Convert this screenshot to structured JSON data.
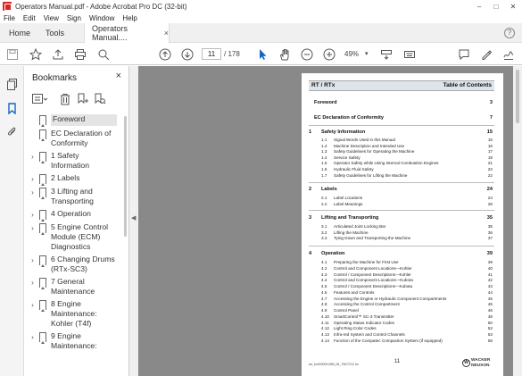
{
  "window": {
    "title": "Operators Manual.pdf - Adobe Acrobat Pro DC (32-bit)",
    "minimize": "–",
    "maximize": "□",
    "close": "✕"
  },
  "menu": [
    "File",
    "Edit",
    "View",
    "Sign",
    "Window",
    "Help"
  ],
  "tabs": {
    "home": "Home",
    "tools": "Tools",
    "doc": "Operators Manual....",
    "close": "×",
    "help": "?"
  },
  "toolbar": {
    "page_current": "11",
    "page_total": "/ 178",
    "zoom": "49%",
    "zoom_arrow": "▾"
  },
  "bookmarks": {
    "header": "Bookmarks",
    "close": "×",
    "items": [
      {
        "label": "Foreword",
        "expand": "",
        "selected": true
      },
      {
        "label": "EC Declaration of Conformity",
        "expand": ""
      },
      {
        "label": "1 Safety Information",
        "expand": "›"
      },
      {
        "label": "2 Labels",
        "expand": "›"
      },
      {
        "label": "3 Lifting and Transporting",
        "expand": "›"
      },
      {
        "label": "4 Operation",
        "expand": "›"
      },
      {
        "label": "5 Engine Control Module (ECM) Diagnostics",
        "expand": "›"
      },
      {
        "label": "6 Changing Drums (RTx-SC3)",
        "expand": "›"
      },
      {
        "label": "7 General Maintenance",
        "expand": "›"
      },
      {
        "label": "8 Engine Maintenance: Kohler (T4f)",
        "expand": "›"
      },
      {
        "label": "9 Engine Maintenance:",
        "expand": "›"
      }
    ]
  },
  "pdf": {
    "header_left": "RT / RTx",
    "header_right": "Table of Contents",
    "main_entries": [
      {
        "num": "",
        "title": "Foreword",
        "page": "3"
      },
      {
        "num": "",
        "title": "EC Declaration of Conformity",
        "page": "7"
      },
      {
        "num": "1",
        "title": "Safety Information",
        "page": "15"
      },
      {
        "num": "2",
        "title": "Labels",
        "page": "24"
      },
      {
        "num": "3",
        "title": "Lifting and Transporting",
        "page": "35"
      },
      {
        "num": "4",
        "title": "Operation",
        "page": "39"
      }
    ],
    "sec1": [
      {
        "n": "1.1",
        "t": "Signal Words Used in this Manual",
        "p": "15"
      },
      {
        "n": "1.2",
        "t": "Machine Description and Intended Use",
        "p": "16"
      },
      {
        "n": "1.3",
        "t": "Safety Guidelines for Operating the Machine",
        "p": "17"
      },
      {
        "n": "1.4",
        "t": "Service Safety",
        "p": "19"
      },
      {
        "n": "1.5",
        "t": "Operator Safety while Using Internal Combustion Engines",
        "p": "21"
      },
      {
        "n": "1.6",
        "t": "Hydraulic Fluid Safety",
        "p": "22"
      },
      {
        "n": "1.7",
        "t": "Safety Guidelines for Lifting the Machine",
        "p": "22"
      }
    ],
    "sec2": [
      {
        "n": "2.1",
        "t": "Label Locations",
        "p": "24"
      },
      {
        "n": "2.2",
        "t": "Label Meanings",
        "p": "26"
      }
    ],
    "sec3": [
      {
        "n": "3.1",
        "t": "Articulated Joint Locking Bar",
        "p": "35"
      },
      {
        "n": "3.2",
        "t": "Lifting the Machine",
        "p": "36"
      },
      {
        "n": "3.3",
        "t": "Tying Down and Transporting the Machine",
        "p": "37"
      }
    ],
    "sec4": [
      {
        "n": "4.1",
        "t": "Preparing the Machine for First Use",
        "p": "39"
      },
      {
        "n": "4.2",
        "t": "Control and Component Locations—Kohler",
        "p": "40"
      },
      {
        "n": "4.3",
        "t": "Control / Component Descriptions—Kohler",
        "p": "41"
      },
      {
        "n": "4.4",
        "t": "Control and Component Locations—Kubota",
        "p": "42"
      },
      {
        "n": "4.5",
        "t": "Control / Component Descriptions—Kubota",
        "p": "43"
      },
      {
        "n": "4.6",
        "t": "Features and Controls",
        "p": "44"
      },
      {
        "n": "4.7",
        "t": "Accessing the Engine or Hydraulic Component Compartments",
        "p": "45"
      },
      {
        "n": "4.8",
        "t": "Accessing the Control Compartment",
        "p": "46"
      },
      {
        "n": "4.9",
        "t": "Control Panel",
        "p": "46"
      },
      {
        "n": "4.10",
        "t": "SmartControl™ SC-3 Transmitter",
        "p": "48"
      },
      {
        "n": "4.11",
        "t": "Operating Status Indicator Codes",
        "p": "50"
      },
      {
        "n": "4.12",
        "t": "Light Ring Color Codes",
        "p": "52"
      },
      {
        "n": "4.13",
        "t": "Infra-red System and Control Channels",
        "p": "53"
      },
      {
        "n": "4.14",
        "t": "Function of the Compatec Compaction System (if equipped)",
        "p": "55"
      }
    ],
    "footer_left": "wc_bo0000001369_06_TWCTOC.fm",
    "footer_page": "11",
    "logo_mark": "W",
    "logo_line1": "WACKER",
    "logo_line2": "NEUSON"
  }
}
